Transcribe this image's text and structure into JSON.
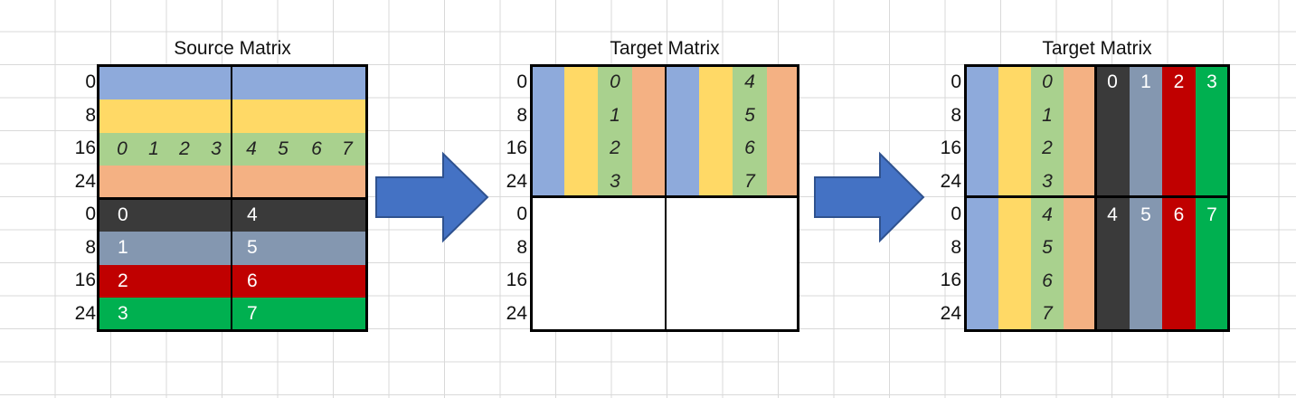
{
  "panels": {
    "source": {
      "title": "Source Matrix",
      "row_labels": [
        "0",
        "8",
        "16",
        "24",
        "0",
        "8",
        "16",
        "24"
      ],
      "left_digits": [
        "0",
        "1",
        "2",
        "3"
      ],
      "right_digits": [
        "4",
        "5",
        "6",
        "7"
      ],
      "dark_left": [
        "0",
        "1",
        "2",
        "3"
      ],
      "dark_right": [
        "4",
        "5",
        "6",
        "7"
      ]
    },
    "target1": {
      "title": "Target Matrix",
      "row_labels": [
        "0",
        "8",
        "16",
        "24",
        "0",
        "8",
        "16",
        "24"
      ],
      "left_digits": [
        "0",
        "1",
        "2",
        "3"
      ],
      "right_digits": [
        "4",
        "5",
        "6",
        "7"
      ]
    },
    "target2": {
      "title": "Target Matrix",
      "row_labels": [
        "0",
        "8",
        "16",
        "24",
        "0",
        "8",
        "16",
        "24"
      ],
      "top_digits": [
        "0",
        "1",
        "2",
        "3"
      ],
      "bottom_digits": [
        "4",
        "5",
        "6",
        "7"
      ],
      "top_right": [
        "0",
        "1",
        "2",
        "3"
      ],
      "bottom_right": [
        "4",
        "5",
        "6",
        "7"
      ]
    }
  },
  "colors": {
    "blue": "#8eaadb",
    "yellow": "#ffd966",
    "green": "#a9d18e",
    "orange": "#f4b183",
    "dark": "#3a3a3a",
    "slate": "#8497b0",
    "red": "#c00000",
    "bright_green": "#00b050",
    "arrow": "#4472c4"
  }
}
